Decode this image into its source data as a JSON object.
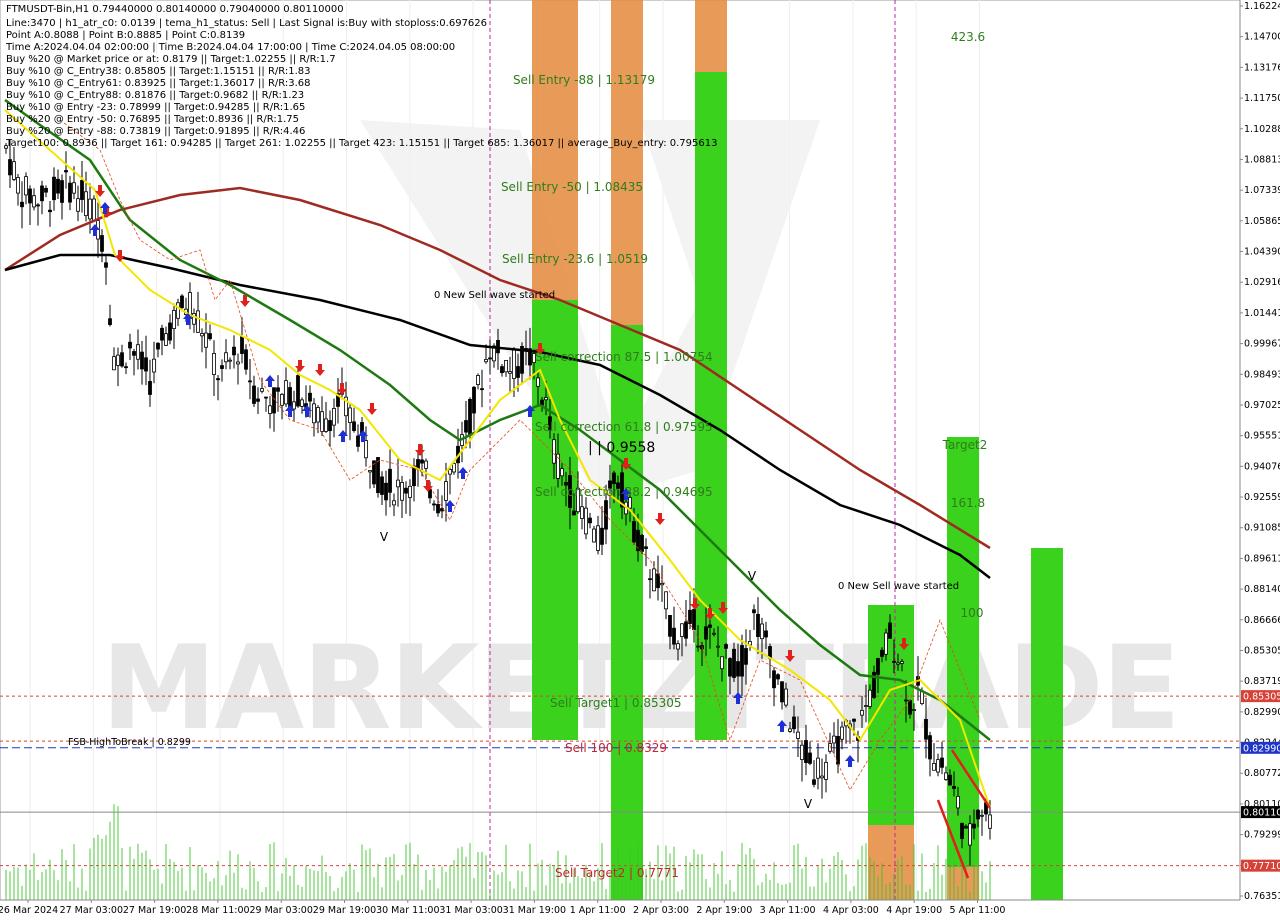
{
  "header": {
    "symbol_line": "FTMUSDT-Bin,H1  0.79440000 0.80140000 0.79040000 0.80110000",
    "info_lines": [
      "Line:3470 | h1_atr_c0: 0.0139 | tema_h1_status: Sell | Last Signal is:Buy with stoploss:0.697626",
      "Point A:0.8088 | Point B:0.8885 | Point C:0.8139",
      "Time A:2024.04.04 02:00:00 | Time B:2024.04.04 17:00:00 | Time C:2024.04.05 08:00:00",
      "Buy %20 @ Market price or at: 0.8179 || Target:1.02255 || R/R:1.7",
      "Buy %10 @ C_Entry38: 0.85805 || Target:1.15151 || R/R:1.83",
      "Buy %10 @ C_Entry61: 0.83925 || Target:1.36017 || R/R:3.68",
      "Buy %10 @ C_Entry88: 0.81876 || Target:0.9682 || R/R:1.23",
      "Buy %10 @ Entry -23: 0.78999 || Target:0.94285 || R/R:1.65",
      "Buy %20 @ Entry -50: 0.76895 || Target:0.8936 || R/R:1.75",
      "Buy %20 @ Entry -88: 0.73819 || Target:0.91895 || R/R:4.46",
      "Target100: 0.8936 || Target 161: 0.94285 || Target 261: 1.02255 || Target 423: 1.15151 || Target 685: 1.36017 || average_Buy_entry: 0.795613"
    ]
  },
  "chart_data": {
    "type": "candlestick",
    "y_ticks": [
      "1.16224",
      "1.14700",
      "1.13176",
      "1.11750",
      "1.10288",
      "1.08813",
      "1.07339",
      "1.05865",
      "1.04390",
      "1.02916",
      "1.01441",
      "0.99967",
      "0.98493",
      "0.97025",
      "0.95551",
      "0.94076",
      "0.92559",
      "0.91085",
      "0.89611",
      "0.88140",
      "0.86666",
      "0.85305",
      "0.83719",
      "0.82990",
      "0.82244",
      "0.80772",
      "0.80110",
      "0.79299",
      "0.77710",
      "0.76351"
    ],
    "highlighted_prices": [
      {
        "label": "0.85305",
        "color": "#d64238"
      },
      {
        "label": "0.82990",
        "color": "#1e36c8"
      },
      {
        "label": "0.80110",
        "color": "#000000"
      },
      {
        "label": "0.77710",
        "color": "#d64238"
      }
    ],
    "x_ticks": [
      "26 Mar 2024",
      "27 Mar 03:00",
      "27 Mar 19:00",
      "28 Mar 11:00",
      "29 Mar 03:00",
      "29 Mar 19:00",
      "30 Mar 11:00",
      "31 Mar 03:00",
      "31 Mar 19:00",
      "1 Apr 11:00",
      "2 Apr 03:00",
      "2 Apr 19:00",
      "3 Apr 11:00",
      "4 Apr 03:00",
      "4 Apr 19:00",
      "5 Apr 11:00"
    ],
    "zone_labels": [
      {
        "text": "Sell Entry -88 | 1.13179",
        "color": "#2e7d1c"
      },
      {
        "text": "Sell Entry -50 | 1.08435",
        "color": "#2e7d1c"
      },
      {
        "text": "Sell Entry -23.6 | 1.0519",
        "color": "#2e7d1c"
      },
      {
        "text": "Sell correction 87.5 | 1.00754",
        "color": "#2e7d1c"
      },
      {
        "text": "Sell correction 61.8 | 0.97595",
        "color": "#2e7d1c"
      },
      {
        "text": "Sell correction 38.2 | 0.94695",
        "color": "#2e7d1c"
      },
      {
        "text": "Sell Target1 | 0.85305",
        "color": "#2e7d1c"
      },
      {
        "text": "Sell 100 | 0.8329",
        "color": "#c1272d"
      },
      {
        "text": "Sell Target2 | 0.7771",
        "color": "#c1272d"
      },
      {
        "text": "423.6",
        "color": "#2e7d1c"
      },
      {
        "text": "Target2",
        "color": "#2e7d1c"
      },
      {
        "text": "161.8",
        "color": "#2e7d1c"
      },
      {
        "text": "100",
        "color": "#2e7d1c"
      }
    ],
    "annotations": [
      {
        "text": "0 New Sell wave started"
      },
      {
        "text": "0 New Sell wave started"
      },
      {
        "text": "| | 0.9558"
      },
      {
        "text": "FSB-HighToBreak | 0.8299"
      }
    ],
    "series": [
      {
        "name": "price",
        "color": "#000000"
      },
      {
        "name": "moving-average-yellow",
        "color": "#f3e600"
      },
      {
        "name": "moving-average-green",
        "color": "#1d7a10"
      },
      {
        "name": "moving-average-black",
        "color": "#000000"
      },
      {
        "name": "moving-average-darkred",
        "color": "#9e2a22"
      }
    ],
    "watermark": "MARKETZITRADE"
  },
  "colors": {
    "zone_green": "#3ad21c",
    "zone_orange": "#e48a3c",
    "buy_arrow": "#1f2fd6",
    "sell_arrow": "#e0201b",
    "vline": "#c2259c"
  }
}
